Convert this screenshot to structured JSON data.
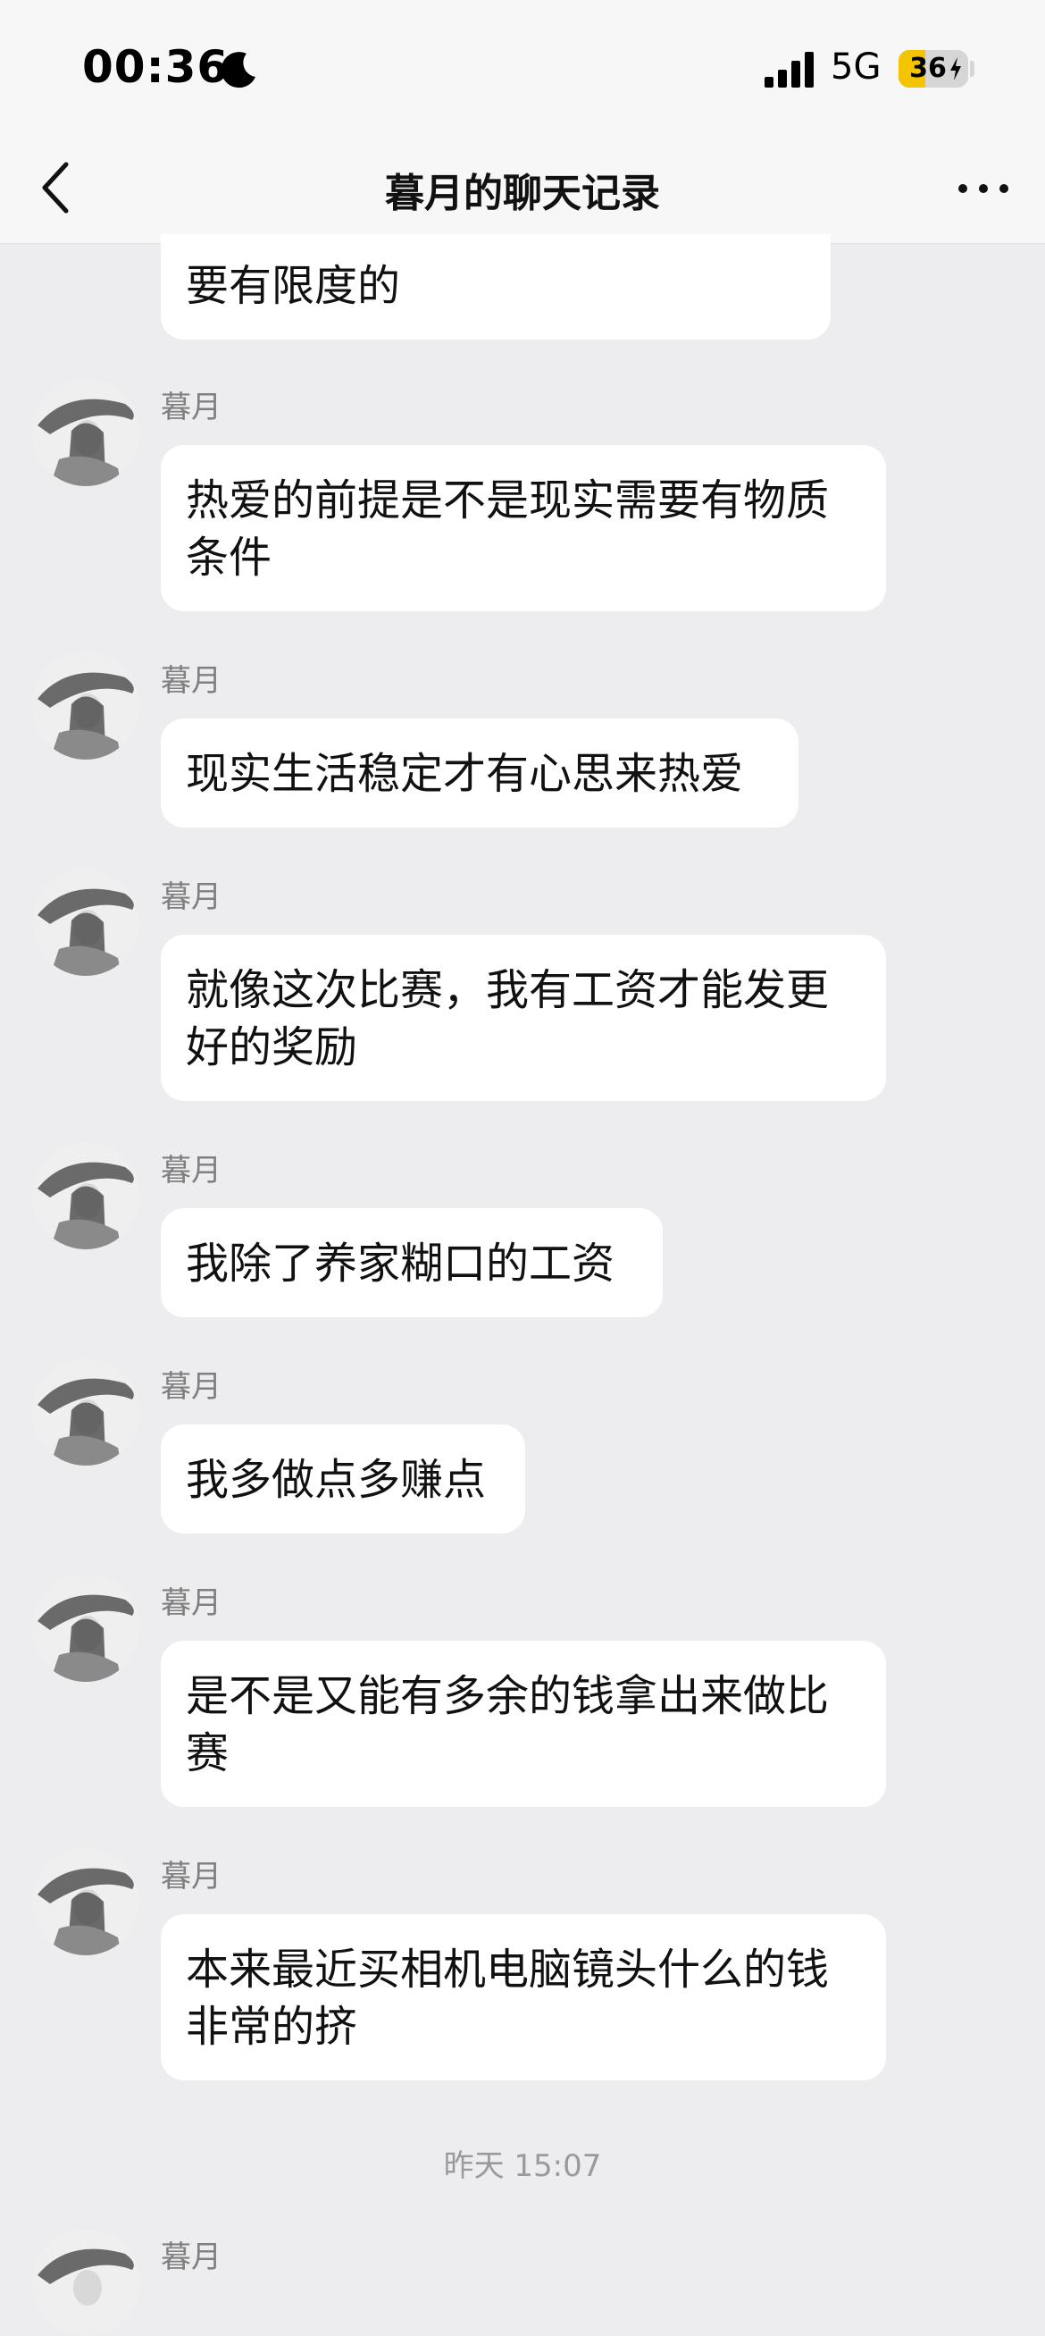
{
  "status_bar": {
    "time": "00:36",
    "network": "5G",
    "battery_level": "36",
    "icons": [
      "moon-icon",
      "signal-icon",
      "battery-charging-icon"
    ]
  },
  "header": {
    "title": "暮月的聊天记录",
    "back_icon": "chevron-left-icon",
    "more_icon": "ellipsis-icon"
  },
  "messages": [
    {
      "text": "要有限度的"
    },
    {
      "sender": "暮月",
      "text": "热爱的前提是不是现实需要有物质条件"
    },
    {
      "sender": "暮月",
      "text": "现实生活稳定才有心思来热爱"
    },
    {
      "sender": "暮月",
      "text": "就像这次比赛，我有工资才能发更好的奖励"
    },
    {
      "sender": "暮月",
      "text": "我除了养家糊口的工资"
    },
    {
      "sender": "暮月",
      "text": "我多做点多赚点"
    },
    {
      "sender": "暮月",
      "text": "是不是又能有多余的钱拿出来做比赛"
    },
    {
      "sender": "暮月",
      "text": "本来最近买相机电脑镜头什么的钱非常的挤"
    }
  ],
  "timestamp": "昨天 15:07",
  "last_sender": "暮月",
  "colors": {
    "background": "#ededf0",
    "bubble": "#ffffff",
    "battery_accent": "#f4c400"
  }
}
